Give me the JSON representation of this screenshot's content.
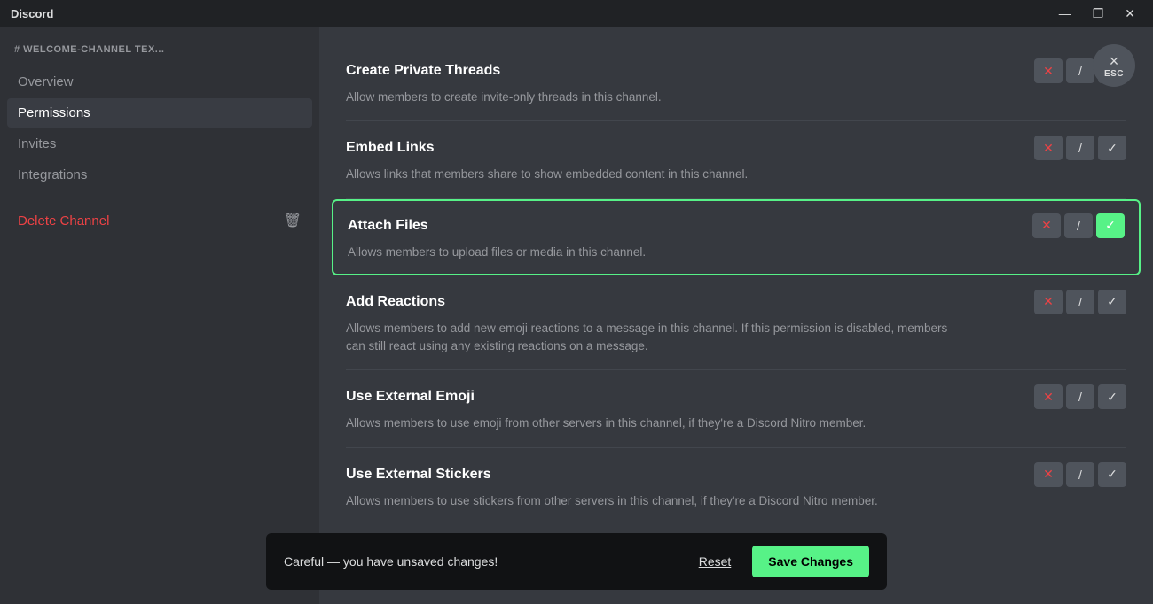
{
  "titlebar": {
    "logo": "Discord",
    "minimize_label": "—",
    "maximize_label": "❐",
    "close_label": "✕"
  },
  "sidebar": {
    "channel_name": "# WELCOME-CHANNEL  TEX...",
    "nav_items": [
      {
        "id": "overview",
        "label": "Overview",
        "active": false
      },
      {
        "id": "permissions",
        "label": "Permissions",
        "active": true
      },
      {
        "id": "invites",
        "label": "Invites",
        "active": false
      },
      {
        "id": "integrations",
        "label": "Integrations",
        "active": false
      }
    ],
    "delete_label": "Delete Channel"
  },
  "esc": {
    "x": "×",
    "label": "ESC"
  },
  "permissions": [
    {
      "id": "create-private-threads",
      "title": "Create Private Threads",
      "desc": "Allow members to create invite-only threads in this channel.",
      "state": "deny",
      "highlighted": false
    },
    {
      "id": "embed-links",
      "title": "Embed Links",
      "desc": "Allows links that members share to show embedded content in this channel.",
      "state": "deny",
      "highlighted": false
    },
    {
      "id": "attach-files",
      "title": "Attach Files",
      "desc": "Allows members to upload files or media in this channel.",
      "state": "allow",
      "highlighted": true
    },
    {
      "id": "add-reactions",
      "title": "Add Reactions",
      "desc": "Allows members to add new emoji reactions to a message in this channel. If this permission is disabled, members can still react using any existing reactions on a message.",
      "state": "neutral",
      "highlighted": false
    },
    {
      "id": "use-external-emoji",
      "title": "Use External Emoji",
      "desc": "Allows members to use emoji from other servers in this channel, if they're a Discord Nitro member.",
      "state": "neutral",
      "highlighted": false
    },
    {
      "id": "use-external-stickers",
      "title": "Use External Stickers",
      "desc": "Allows members to use stickers from other servers in this channel, if they're a Discord Nitro member.",
      "state": "deny",
      "highlighted": false
    }
  ],
  "unsaved_bar": {
    "warning_text": "Careful — you have unsaved changes!",
    "reset_label": "Reset",
    "save_label": "Save Changes"
  }
}
